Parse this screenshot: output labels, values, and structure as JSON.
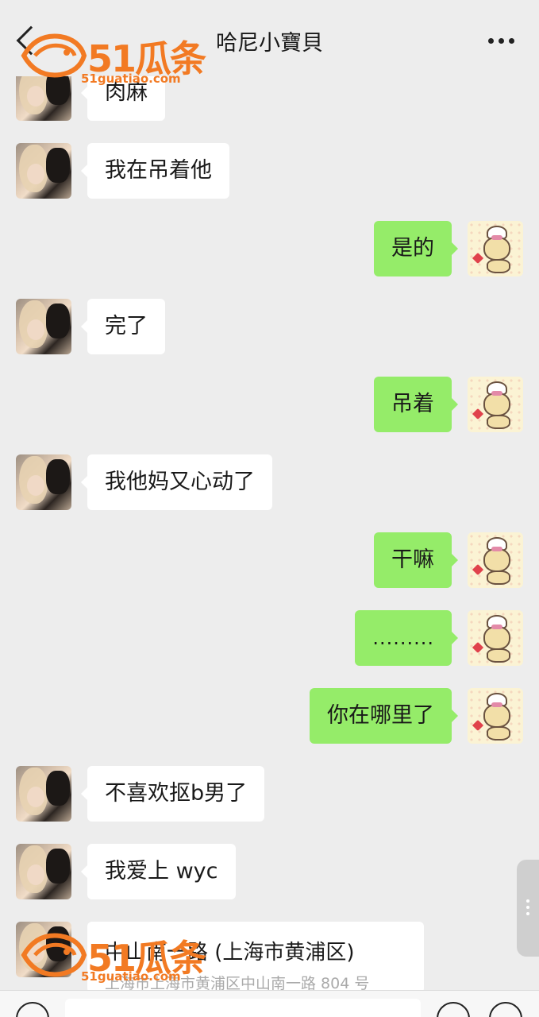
{
  "header": {
    "title": "哈尼小寶貝",
    "back_icon": "chevron-left-icon",
    "more_icon": "more-dots-icon"
  },
  "watermark": {
    "brand": "51瓜条",
    "url": "51guatiao.com",
    "color": "#f27a23"
  },
  "messages": [
    {
      "side": "in",
      "text": "肉麻"
    },
    {
      "side": "in",
      "text": "我在吊着他"
    },
    {
      "side": "out",
      "text": "是的"
    },
    {
      "side": "in",
      "text": "完了"
    },
    {
      "side": "out",
      "text": "吊着"
    },
    {
      "side": "in",
      "text": "我他妈又心动了"
    },
    {
      "side": "out",
      "text": "干嘛"
    },
    {
      "side": "out",
      "text": "........."
    },
    {
      "side": "out",
      "text": "你在哪里了"
    },
    {
      "side": "in",
      "text": "不喜欢抠b男了"
    },
    {
      "side": "in",
      "text": "我爱上 wyc"
    }
  ],
  "location": {
    "name": "中山南一路 (上海市黄浦区)",
    "address": "上海市上海市黄浦区中山南一路 804 号"
  },
  "colors": {
    "background": "#ededed",
    "incoming_bubble": "#ffffff",
    "outgoing_bubble": "#95ec69"
  }
}
